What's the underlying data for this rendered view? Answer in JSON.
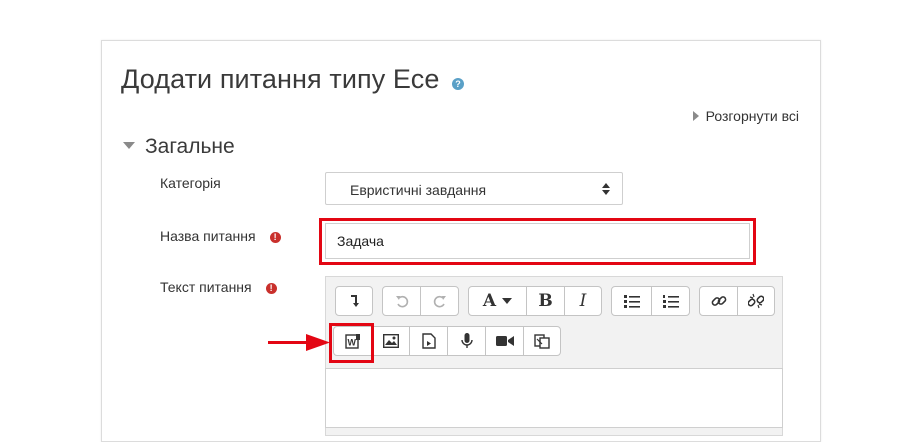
{
  "page": {
    "title": "Додати питання типу Есе",
    "expand_all": "Розгорнути всі"
  },
  "section": {
    "general": "Загальне"
  },
  "fields": {
    "category": {
      "label": "Категорія",
      "value": "Евристичні завдання"
    },
    "question_name": {
      "label": "Назва питання",
      "value": "Задача"
    },
    "question_text": {
      "label": "Текст питання"
    }
  },
  "toolbar": {
    "row1": [
      "expand-toolbar",
      "undo",
      "redo",
      "font-color",
      "bold",
      "italic",
      "unordered-list",
      "ordered-list",
      "link",
      "unlink"
    ],
    "row2": [
      "word-import",
      "image",
      "media",
      "record-audio",
      "record-video",
      "paste-special"
    ],
    "font_letter": "A",
    "bold_letter": "B",
    "italic_letter": "I"
  },
  "colors": {
    "highlight": "#e30613",
    "required": "#c9302c",
    "help": "#5aa0c7"
  }
}
